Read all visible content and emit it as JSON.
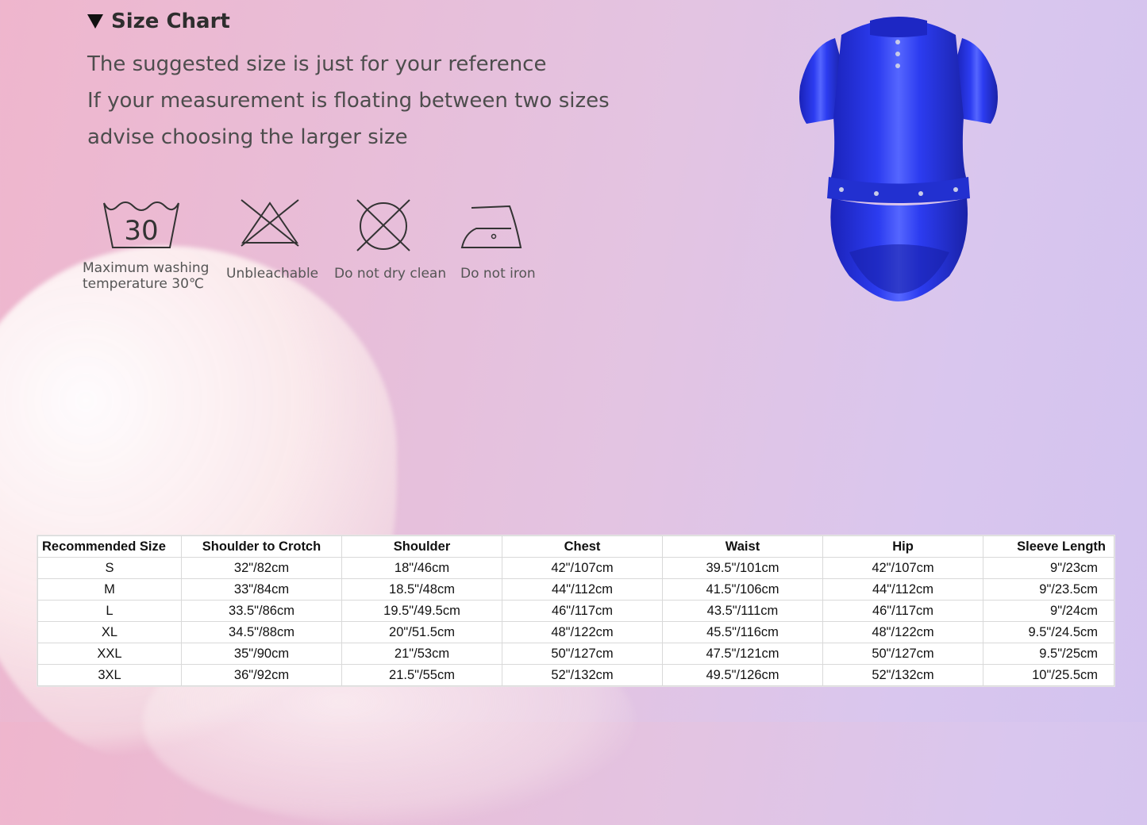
{
  "header": {
    "title": "Size Chart"
  },
  "notes": [
    "The suggested size is just for your reference",
    "If your measurement is floating between two sizes",
    "advise choosing the larger size"
  ],
  "care_icons": [
    {
      "icon": "wash-30-icon",
      "number": "30",
      "label_line1": "Maximum washing",
      "label_line2": "temperature 30℃"
    },
    {
      "icon": "no-bleach-icon",
      "label": "Unbleachable"
    },
    {
      "icon": "no-dry-clean-icon",
      "label": "Do not dry clean"
    },
    {
      "icon": "no-iron-icon",
      "label": "Do not iron"
    }
  ],
  "product": {
    "icon": "blue-bodysuit-image",
    "color": "#2433d6"
  },
  "table": {
    "headers": [
      "Recommended Size",
      "Shoulder to Crotch",
      "Shoulder",
      "Chest",
      "Waist",
      "Hip",
      "Sleeve Length"
    ],
    "rows": [
      [
        "S",
        "32\"/82cm",
        "18\"/46cm",
        "42\"/107cm",
        "39.5\"/101cm",
        "42\"/107cm",
        "9\"/23cm"
      ],
      [
        "M",
        "33\"/84cm",
        "18.5\"/48cm",
        "44\"/112cm",
        "41.5\"/106cm",
        "44\"/112cm",
        "9\"/23.5cm"
      ],
      [
        "L",
        "33.5\"/86cm",
        "19.5\"/49.5cm",
        "46\"/117cm",
        "43.5\"/111cm",
        "46\"/117cm",
        "9\"/24cm"
      ],
      [
        "XL",
        "34.5\"/88cm",
        "20\"/51.5cm",
        "48\"/122cm",
        "45.5\"/116cm",
        "48\"/122cm",
        "9.5\"/24.5cm"
      ],
      [
        "XXL",
        "35\"/90cm",
        "21\"/53cm",
        "50\"/127cm",
        "47.5\"/121cm",
        "50\"/127cm",
        "9.5\"/25cm"
      ],
      [
        "3XL",
        "36\"/92cm",
        "21.5\"/55cm",
        "52\"/132cm",
        "49.5\"/126cm",
        "52\"/132cm",
        "10\"/25.5cm"
      ]
    ]
  }
}
